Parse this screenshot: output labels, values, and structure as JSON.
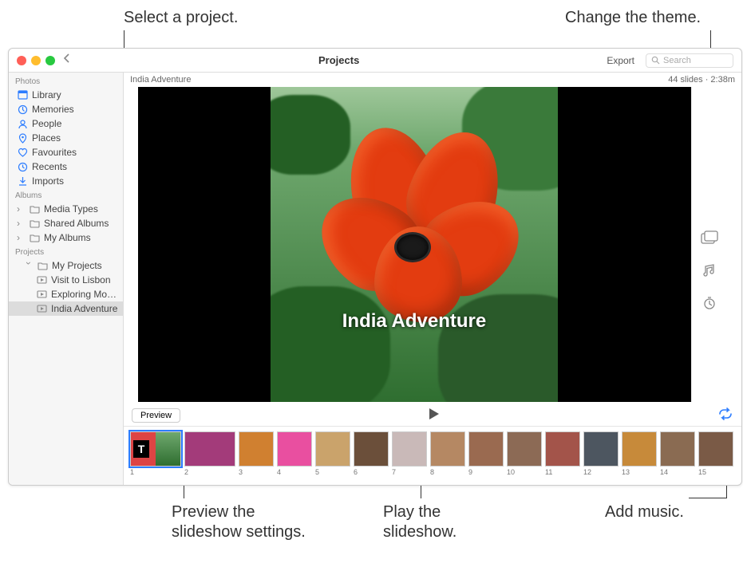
{
  "callouts": {
    "select_project": "Select a project.",
    "change_theme": "Change the theme.",
    "preview_settings_l1": "Preview the",
    "preview_settings_l2": "slideshow settings.",
    "play_slideshow_l1": "Play the",
    "play_slideshow_l2": "slideshow.",
    "add_music": "Add music."
  },
  "titlebar": {
    "title": "Projects",
    "export": "Export",
    "search_placeholder": "Search"
  },
  "sidebar": {
    "photos_head": "Photos",
    "library": "Library",
    "memories": "Memories",
    "people": "People",
    "places": "Places",
    "favourites": "Favourites",
    "recents": "Recents",
    "imports": "Imports",
    "albums_head": "Albums",
    "media_types": "Media Types",
    "shared_albums": "Shared Albums",
    "my_albums": "My Albums",
    "projects_head": "Projects",
    "my_projects": "My Projects",
    "visit_to_lisbon": "Visit to Lisbon",
    "exploring_more": "Exploring Mor…",
    "india_adventure": "India Adventure"
  },
  "main": {
    "project_name": "India Adventure",
    "slide_title": "India Adventure",
    "slide_info": "44 slides · 2:38m"
  },
  "controls": {
    "preview": "Preview"
  },
  "thumbs": [
    "1",
    "2",
    "3",
    "4",
    "5",
    "6",
    "7",
    "8",
    "9",
    "10",
    "11",
    "12",
    "13",
    "14",
    "15"
  ],
  "thumb_colors": [
    "#d44",
    "#a33b7a",
    "#d08030",
    "#e94fa0",
    "#caa36b",
    "#6b4f3a",
    "#c9b9b8",
    "#b58863",
    "#9a6a50",
    "#8c6a55",
    "#a3544a",
    "#4d5660",
    "#c78a3a",
    "#8a6b52",
    "#7a5a46"
  ]
}
